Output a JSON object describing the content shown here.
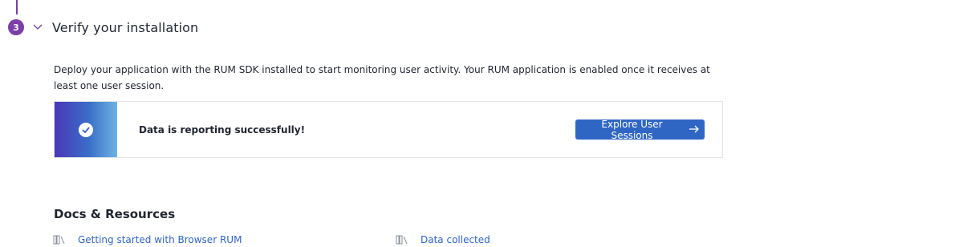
{
  "step": {
    "number": "3",
    "title": "Verify your installation",
    "description": "Deploy your application with the RUM SDK installed to start monitoring user activity. Your RUM application is enabled once it receives at least one user session."
  },
  "status": {
    "message": "Data is reporting successfully!",
    "button_label": "Explore User Sessions",
    "icon": "check-circle-icon"
  },
  "docs": {
    "title": "Docs & Resources",
    "links": [
      {
        "label": "Getting started with Browser RUM",
        "icon": "book-icon"
      },
      {
        "label": "Data collected",
        "icon": "book-icon"
      }
    ]
  },
  "colors": {
    "accent_purple": "#7b3fa8",
    "button_blue": "#2f66c4",
    "link_blue": "#2f66c4"
  }
}
